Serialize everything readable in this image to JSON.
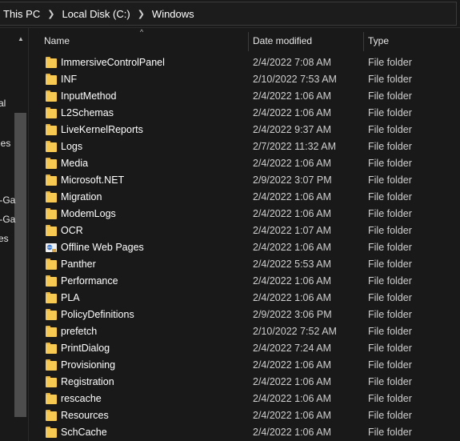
{
  "breadcrumb": {
    "items": [
      "This PC",
      "Local Disk (C:)",
      "Windows"
    ],
    "separator": ">"
  },
  "nav_pane": {
    "items": [
      "al",
      "les",
      "t-Ga",
      "t-Ga",
      "es"
    ]
  },
  "columns": {
    "name": "Name",
    "date_modified": "Date modified",
    "type": "Type",
    "sort_indicator": "^"
  },
  "files": [
    {
      "name": "ImmersiveControlPanel",
      "date": "2/4/2022 7:08 AM",
      "type": "File folder",
      "icon": "folder-icon"
    },
    {
      "name": "INF",
      "date": "2/10/2022 7:53 AM",
      "type": "File folder",
      "icon": "folder-icon"
    },
    {
      "name": "InputMethod",
      "date": "2/4/2022 1:06 AM",
      "type": "File folder",
      "icon": "folder-icon"
    },
    {
      "name": "L2Schemas",
      "date": "2/4/2022 1:06 AM",
      "type": "File folder",
      "icon": "folder-icon"
    },
    {
      "name": "LiveKernelReports",
      "date": "2/4/2022 9:37 AM",
      "type": "File folder",
      "icon": "folder-icon"
    },
    {
      "name": "Logs",
      "date": "2/7/2022 11:32 AM",
      "type": "File folder",
      "icon": "folder-icon"
    },
    {
      "name": "Media",
      "date": "2/4/2022 1:06 AM",
      "type": "File folder",
      "icon": "folder-icon"
    },
    {
      "name": "Microsoft.NET",
      "date": "2/9/2022 3:07 PM",
      "type": "File folder",
      "icon": "folder-icon"
    },
    {
      "name": "Migration",
      "date": "2/4/2022 1:06 AM",
      "type": "File folder",
      "icon": "folder-icon"
    },
    {
      "name": "ModemLogs",
      "date": "2/4/2022 1:06 AM",
      "type": "File folder",
      "icon": "folder-icon"
    },
    {
      "name": "OCR",
      "date": "2/4/2022 1:07 AM",
      "type": "File folder",
      "icon": "folder-icon"
    },
    {
      "name": "Offline Web Pages",
      "date": "2/4/2022 1:06 AM",
      "type": "File folder",
      "icon": "offline-web-pages-icon"
    },
    {
      "name": "Panther",
      "date": "2/4/2022 5:53 AM",
      "type": "File folder",
      "icon": "folder-icon"
    },
    {
      "name": "Performance",
      "date": "2/4/2022 1:06 AM",
      "type": "File folder",
      "icon": "folder-icon"
    },
    {
      "name": "PLA",
      "date": "2/4/2022 1:06 AM",
      "type": "File folder",
      "icon": "folder-icon"
    },
    {
      "name": "PolicyDefinitions",
      "date": "2/9/2022 3:06 PM",
      "type": "File folder",
      "icon": "folder-icon"
    },
    {
      "name": "prefetch",
      "date": "2/10/2022 7:52 AM",
      "type": "File folder",
      "icon": "folder-icon"
    },
    {
      "name": "PrintDialog",
      "date": "2/4/2022 7:24 AM",
      "type": "File folder",
      "icon": "folder-icon"
    },
    {
      "name": "Provisioning",
      "date": "2/4/2022 1:06 AM",
      "type": "File folder",
      "icon": "folder-icon"
    },
    {
      "name": "Registration",
      "date": "2/4/2022 1:06 AM",
      "type": "File folder",
      "icon": "folder-icon"
    },
    {
      "name": "rescache",
      "date": "2/4/2022 1:06 AM",
      "type": "File folder",
      "icon": "folder-icon"
    },
    {
      "name": "Resources",
      "date": "2/4/2022 1:06 AM",
      "type": "File folder",
      "icon": "folder-icon"
    },
    {
      "name": "SchCache",
      "date": "2/4/2022 1:06 AM",
      "type": "File folder",
      "icon": "folder-icon"
    }
  ],
  "colors": {
    "background": "#191919",
    "folder": "#f7c951",
    "text": "#ffffff",
    "secondary_text": "#cfcfcf"
  }
}
